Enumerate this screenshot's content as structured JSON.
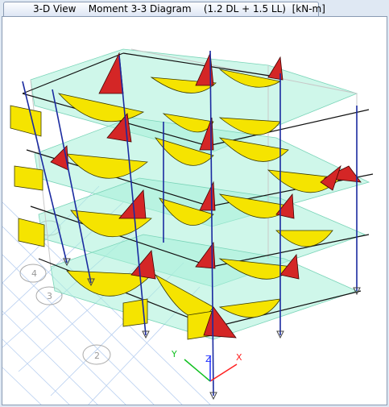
{
  "window": {
    "tab_title": "3-D View    Moment 3-3 Diagram    (1.2 DL + 1.5 LL)  [kN-m]"
  },
  "viewport": {
    "grid_bubbles": [
      "4",
      "3",
      "2"
    ],
    "axes": {
      "x": "X",
      "y": "Y",
      "z": "Z"
    }
  },
  "colors": {
    "positive_moment_fill": "#f5e400",
    "negative_moment_fill": "#d42626",
    "slab_fill": "#a8f0d8",
    "column": "#1a2aa0",
    "beam": "#111111",
    "grid": "#b8cff0",
    "axis_x": "#ff2020",
    "axis_y": "#10c020",
    "axis_z": "#2030ff"
  }
}
